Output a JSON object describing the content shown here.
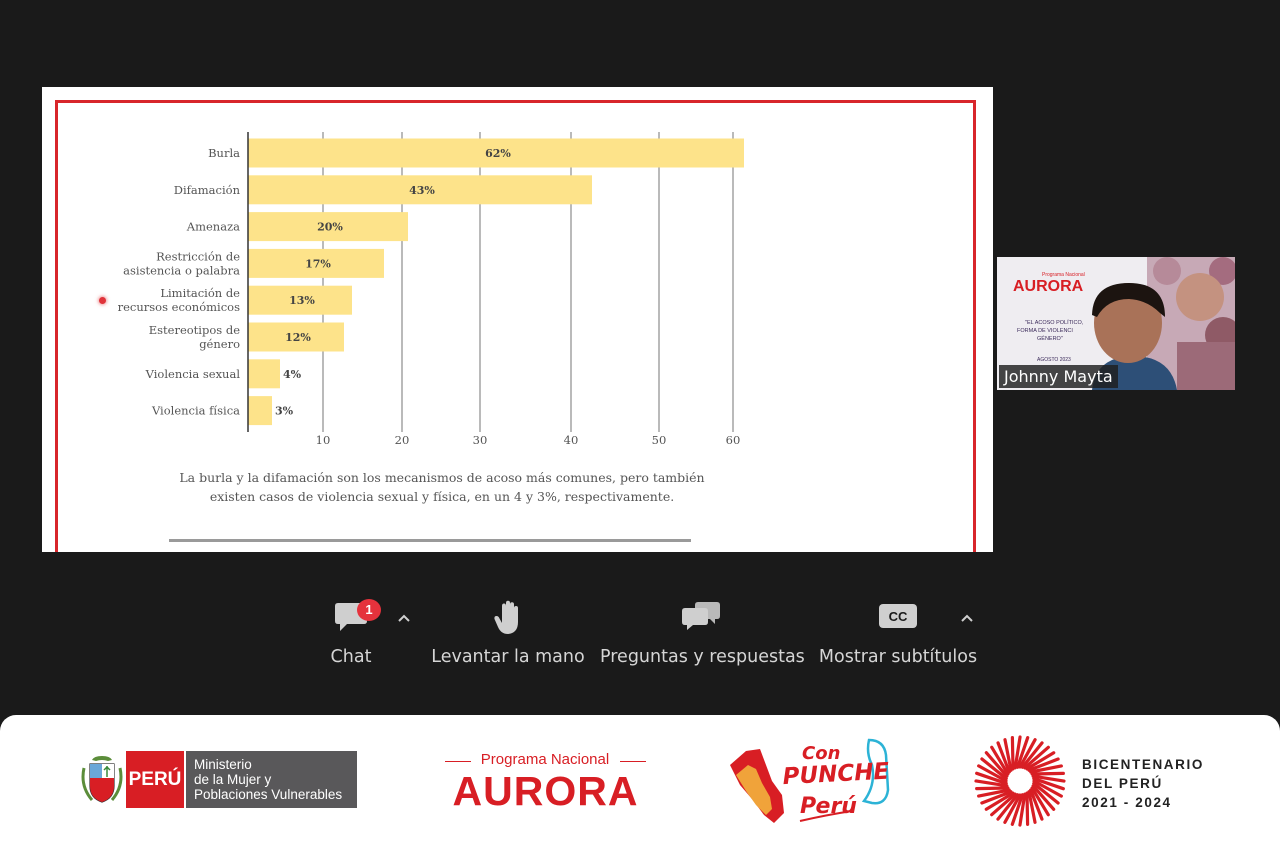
{
  "chart_data": {
    "type": "bar",
    "orientation": "horizontal",
    "categories": [
      [
        "Burla"
      ],
      [
        "Difamación"
      ],
      [
        "Amenaza"
      ],
      [
        "Restricción de",
        "asistencia o palabra"
      ],
      [
        "Limitación de",
        "recursos económicos"
      ],
      [
        "Estereotipos de",
        "género"
      ],
      [
        "Violencia sexual"
      ],
      [
        "Violencia física"
      ]
    ],
    "values": [
      62,
      43,
      20,
      17,
      13,
      12,
      4,
      3
    ],
    "data_labels": [
      "62%",
      "43%",
      "20%",
      "17%",
      "13%",
      "12%",
      "4%",
      "3%"
    ],
    "x_ticks": [
      10,
      20,
      30,
      40,
      50,
      60
    ],
    "xlim": [
      0,
      60
    ],
    "grid": true,
    "bar_color": "#fde38a",
    "gridline_color": "#8c8c8c"
  },
  "slide": {
    "caption": "La burla y la difamación son los mecanismos de acoso más comunes, pero también existen casos de violencia sexual y física, en un 4 y 3%, respectivamente.",
    "frame_color": "#d8262b"
  },
  "participant": {
    "name": "Johnny Mayta",
    "poster_brand_small": "Programa Nacional",
    "poster_brand": "AURORA",
    "poster_lines": [
      "\"EL ACOSO POLÍTICO,",
      "FORMA DE VIOLENCI",
      "GÉNERO\""
    ],
    "poster_date": "AGOSTO 2023"
  },
  "toolbar": {
    "chat_label": "Chat",
    "chat_badge": "1",
    "raise_hand_label": "Levantar la mano",
    "qa_label": "Preguntas y respuestas",
    "cc_icon_text": "CC",
    "captions_label": "Mostrar subtítulos"
  },
  "footer": {
    "peru_label": "PERÚ",
    "ministry_lines": [
      "Ministerio",
      "de la Mujer y",
      "Poblaciones Vulnerables"
    ],
    "aurora_small": "Programa Nacional",
    "aurora_big": "AURORA",
    "punche_lines": [
      "Con",
      "PUNCHE",
      "Perú"
    ],
    "bicentenario_lines": [
      "BICENTENARIO",
      "DEL PERÚ",
      "2021 - 2024"
    ]
  },
  "colors": {
    "background": "#1a1a1a",
    "brand_red": "#d81e24",
    "badge_red": "#e5323c",
    "toolbar_text": "#d5d5d5"
  }
}
